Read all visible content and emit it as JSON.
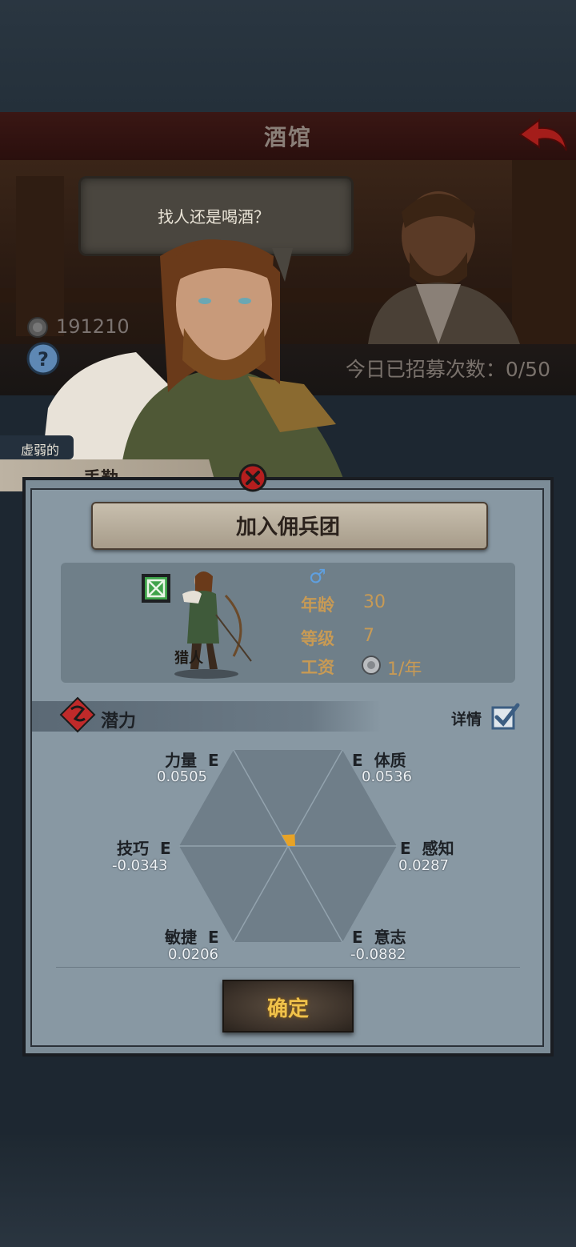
{
  "header": {
    "title": "酒馆"
  },
  "npc": {
    "speech": "找人还是喝酒？"
  },
  "resources": {
    "gold": "191210",
    "recruit_count": "今日已招募次数：0/50"
  },
  "recruit": {
    "trait": "虚弱的",
    "name": "丢勒"
  },
  "dialog": {
    "title": "加入佣兵团",
    "class_name": "猎人",
    "gender_symbol": "♂",
    "age_label": "年龄",
    "age_value": "30",
    "level_label": "等级",
    "level_value": "7",
    "salary_label": "工资",
    "salary_value": "1/年",
    "potential_label": "潜力",
    "detail_label": "详情",
    "detail_checked": true,
    "attributes": [
      {
        "name": "力量",
        "grade": "E",
        "value": "0.0505"
      },
      {
        "name": "体质",
        "grade": "E",
        "value": "0.0536"
      },
      {
        "name": "技巧",
        "grade": "E",
        "value": "-0.0343"
      },
      {
        "name": "感知",
        "grade": "E",
        "value": "0.0287"
      },
      {
        "name": "敏捷",
        "grade": "E",
        "value": "0.0206"
      },
      {
        "name": "意志",
        "grade": "E",
        "value": "-0.0882"
      }
    ],
    "confirm_label": "确定"
  },
  "colors": {
    "accent": "#c79a55",
    "button_text": "#f0c24a",
    "radar_fill": "#e8a326"
  }
}
